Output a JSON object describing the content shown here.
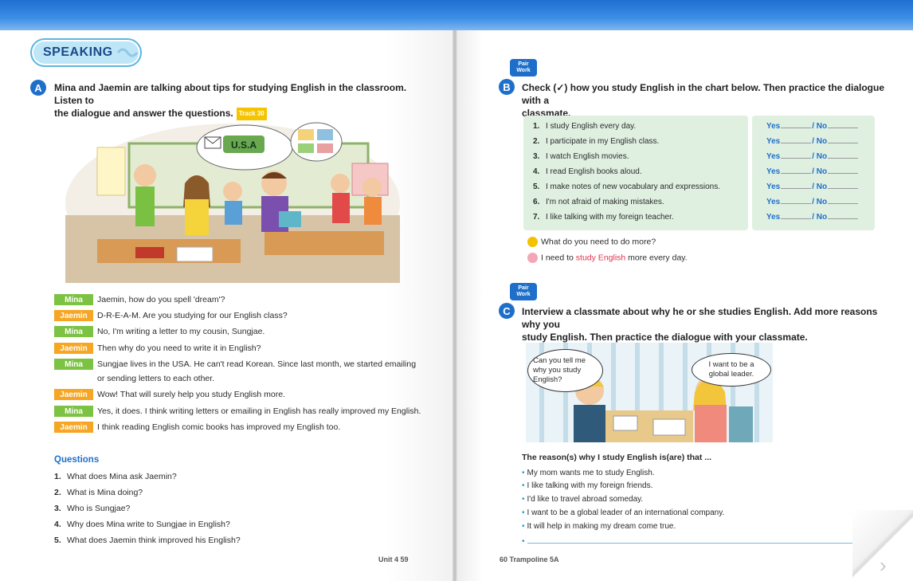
{
  "left_page": {
    "section_title": "SPEAKING",
    "a_label": "A",
    "a_instruction_line1": "Mina and Jaemin are talking about tips for studying English in the classroom. Listen to",
    "a_instruction_line2": "the dialogue and answer the questions.",
    "track": "Track 30",
    "illustration": {
      "speech_text": "U.S.A"
    },
    "dialogue": [
      {
        "speaker": "Mina",
        "color": "#7cc243",
        "line1": "Jaemin, how do you spell 'dream'?"
      },
      {
        "speaker": "Jaemin",
        "color": "#f6a623",
        "line1": "D-R-E-A-M. Are you studying for our English class?"
      },
      {
        "speaker": "Mina",
        "color": "#7cc243",
        "line1": "No, I'm writing a letter to my cousin, Sungjae."
      },
      {
        "speaker": "Jaemin",
        "color": "#f6a623",
        "line1": "Then why do you need to write it in English?"
      },
      {
        "speaker": "Mina",
        "color": "#7cc243",
        "line1": "Sungjae lives in the USA. He can't read Korean. Since last month, we started emailing",
        "line2": "or sending letters to each other."
      },
      {
        "speaker": "Jaemin",
        "color": "#f6a623",
        "line1": "Wow! That will surely help you study English more."
      },
      {
        "speaker": "Mina",
        "color": "#7cc243",
        "line1": "Yes, it does. I think writing letters or emailing in English has really improved my English."
      },
      {
        "speaker": "Jaemin",
        "color": "#f6a623",
        "line1": "I think reading English comic books has improved my English too."
      }
    ],
    "questions_heading": "Questions",
    "questions": [
      {
        "n": "1.",
        "text": "What does Mina ask Jaemin?"
      },
      {
        "n": "2.",
        "text": "What is Mina doing?"
      },
      {
        "n": "3.",
        "text": "Who is Sungjae?"
      },
      {
        "n": "4.",
        "text": "Why does Mina write to Sungjae in English?"
      },
      {
        "n": "5.",
        "text": "What does Jaemin think improved his English?"
      }
    ],
    "page_number": "Unit 4 59"
  },
  "right_page": {
    "pair_work": "Pair Work",
    "b_label": "B",
    "b_instruction_line1": "Check (✓) how you study English in the chart below. Then practice the dialogue with a",
    "b_instruction_line2": "classmate.",
    "chart_rows": [
      {
        "n": "1.",
        "text": "I study English every day."
      },
      {
        "n": "2.",
        "text": "I participate in my English class."
      },
      {
        "n": "3.",
        "text": "I watch English movies."
      },
      {
        "n": "4.",
        "text": "I read English books aloud."
      },
      {
        "n": "5.",
        "text": "I make notes of new vocabulary and expressions."
      },
      {
        "n": "6.",
        "text": "I'm not afraid of making mistakes."
      },
      {
        "n": "7.",
        "text": "I like talking with my foreign teacher."
      }
    ],
    "yes_label": "Yes",
    "no_label": "/ No",
    "dialogue_a": "What do you need to do more?",
    "dialogue_b_prefix": "I need to ",
    "dialogue_b_highlight": "study English",
    "dialogue_b_suffix": " more every day.",
    "c_label": "C",
    "c_instruction_line1": "Interview a classmate about why he or she studies English. Add more reasons why you",
    "c_instruction_line2": "study English. Then practice the dialogue with your classmate.",
    "bubble_left": "Can you tell me why you study English?",
    "bubble_right": "I want to be a global leader.",
    "reasons_heading": "The reason(s) why I study English is(are) that ...",
    "reasons": [
      "My mom wants me to study English.",
      "I like talking with my foreign friends.",
      "I'd like to travel abroad someday.",
      "I want to be a global leader of an international company.",
      "It will help in making my dream come true."
    ],
    "page_number": "60 Trampoline 5A"
  }
}
